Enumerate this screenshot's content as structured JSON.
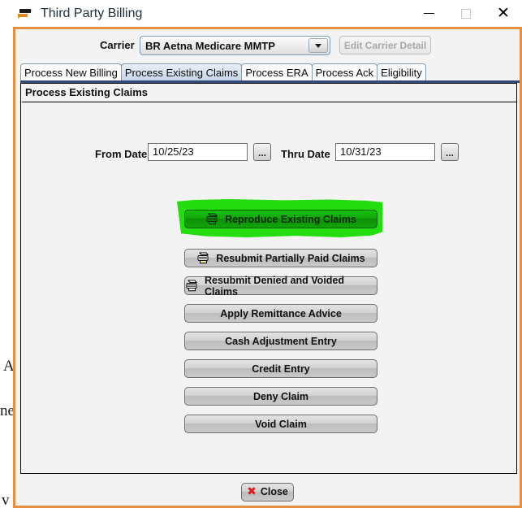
{
  "window": {
    "title": "Third Party Billing",
    "icon": "billing-arrow-icon",
    "accent_color": "#e59040",
    "controls": {
      "minimize": "minimize-icon",
      "maximize": "maximize-icon",
      "close": "close-icon"
    }
  },
  "carrier": {
    "label": "Carrier",
    "value": "BR Aetna Medicare  MMTP",
    "dropdown_icon": "chevron-down-icon",
    "edit_button": "Edit Carrier Detail",
    "edit_button_enabled": false
  },
  "tabs": [
    {
      "label": "Process New Billing",
      "selected": false
    },
    {
      "label": "Process Existing Claims",
      "selected": true
    },
    {
      "label": "Process ERA",
      "selected": false
    },
    {
      "label": "Process Ack",
      "selected": false
    },
    {
      "label": "Eligibility",
      "selected": false
    }
  ],
  "panel": {
    "title": "Process Existing Claims",
    "from_date": {
      "label": "From Date",
      "value": "10/25/23",
      "browse_label": "..."
    },
    "thru_date": {
      "label": "Thru Date",
      "value": "10/31/23",
      "browse_label": "..."
    },
    "actions": [
      {
        "label": "Reproduce Existing Claims",
        "icon": "printer-icon",
        "highlighted": true
      },
      {
        "label": "Resubmit Partially Paid Claims",
        "icon": "printer-icon",
        "highlighted": false
      },
      {
        "label": "Resubmit Denied and Voided Claims",
        "icon": "printer-icon",
        "highlighted": false
      },
      {
        "label": "Apply Remittance Advice",
        "icon": null,
        "highlighted": false
      },
      {
        "label": "Cash Adjustment Entry",
        "icon": null,
        "highlighted": false
      },
      {
        "label": "Credit Entry",
        "icon": null,
        "highlighted": false
      },
      {
        "label": "Deny Claim",
        "icon": null,
        "highlighted": false
      },
      {
        "label": "Void Claim",
        "icon": null,
        "highlighted": false
      }
    ]
  },
  "footer": {
    "close_label": "Close",
    "close_icon": "red-x-icon"
  },
  "highlight": {
    "color": "#23dd0f",
    "target": "Reproduce Existing Claims"
  },
  "background": {
    "fragment_1": "A",
    "fragment_2": "ne",
    "fragment_3": "v"
  }
}
